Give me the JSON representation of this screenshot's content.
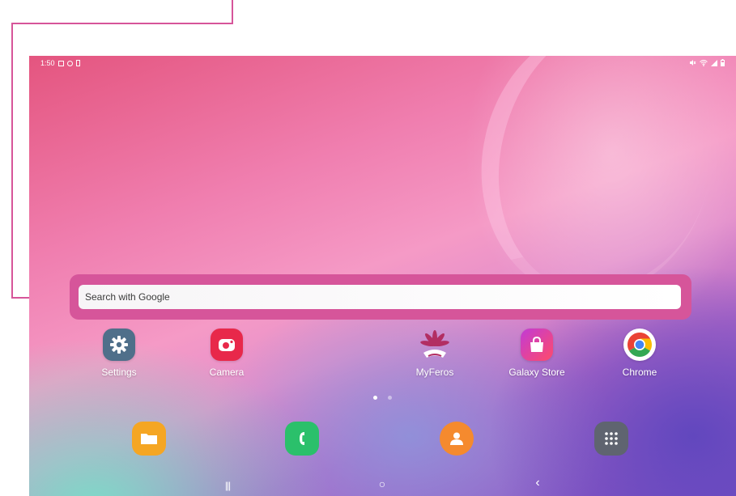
{
  "status_bar": {
    "time": "1:50",
    "left_icons": [
      "gallery-icon",
      "gear-icon",
      "battery-saver-icon"
    ],
    "right_icons": [
      "mute-icon",
      "wifi-icon",
      "signal-icon",
      "battery-icon"
    ]
  },
  "search": {
    "placeholder": "Search with Google"
  },
  "apps": [
    {
      "label": "Settings",
      "icon": "settings-icon",
      "color": "#4f6f8a"
    },
    {
      "label": "Camera",
      "icon": "camera-icon",
      "color": "#e8284a"
    },
    {
      "label": "MyFeros",
      "icon": "myferos-icon",
      "color": "#b22e63"
    },
    {
      "label": "Galaxy Store",
      "icon": "galaxy-store-icon",
      "color": "#ef3e6b"
    },
    {
      "label": "Chrome",
      "icon": "chrome-icon",
      "color": "#ffffff"
    }
  ],
  "page_indicator": {
    "current": 1,
    "total": 2
  },
  "dock": [
    {
      "icon": "my-files-icon",
      "color": "#f5a623"
    },
    {
      "icon": "phone-icon",
      "color": "#2bc06b"
    },
    {
      "icon": "contacts-icon",
      "color": "#f58a2e"
    },
    {
      "icon": "apps-drawer-icon",
      "color": "#5f6470"
    }
  ],
  "nav_bar": {
    "recents_glyph": "|||",
    "home_glyph": "○",
    "back_glyph": "‹"
  },
  "colors": {
    "highlight": "#d6559a"
  }
}
